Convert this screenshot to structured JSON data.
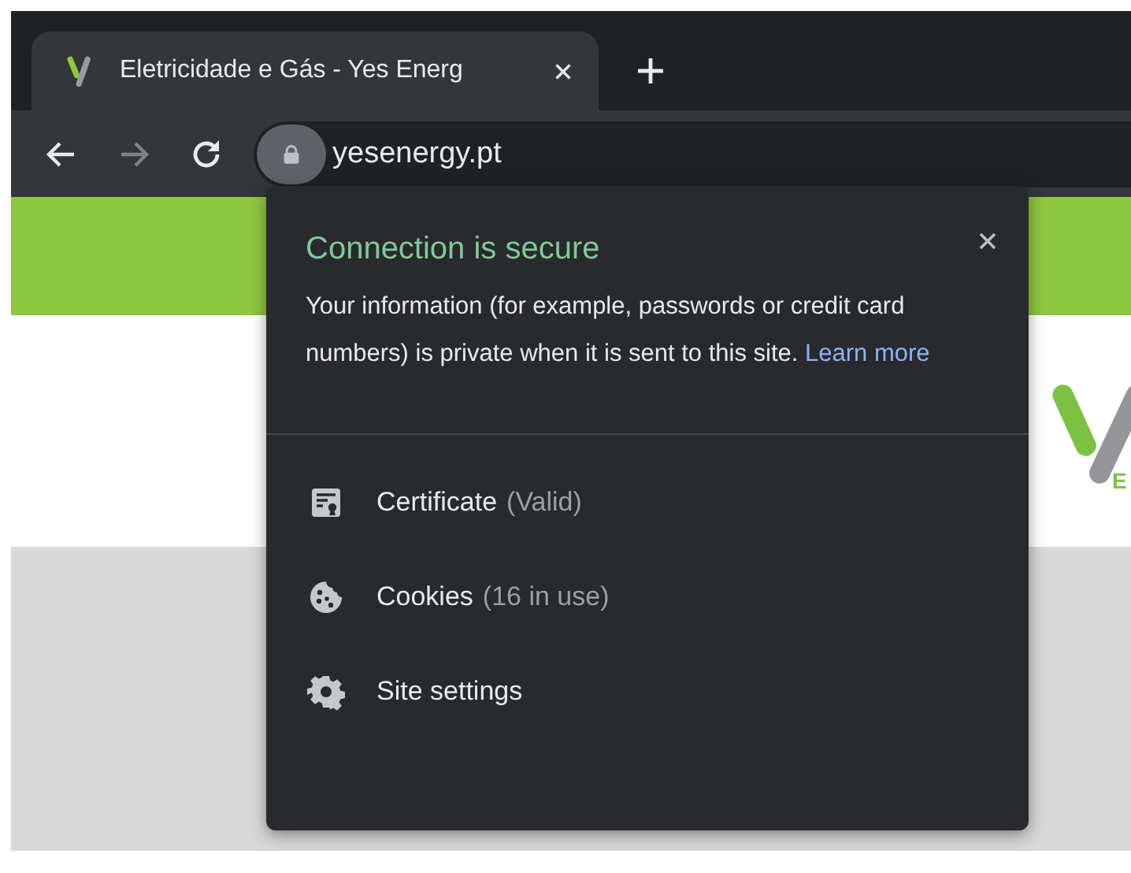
{
  "tabs": [
    {
      "title": "Eletricidade e Gás - Yes Energ",
      "selected": true
    }
  ],
  "toolbar": {
    "buttons": [
      {
        "kind": "back",
        "disabled": false
      },
      {
        "kind": "forward",
        "disabled": true
      },
      {
        "kind": "reload",
        "disabled": false
      }
    ]
  },
  "address_bar": {
    "url": "yesenergy.pt"
  },
  "page": {
    "logo_letter": "E"
  },
  "popup": {
    "title": "Connection is secure",
    "message": "Your information (for example, passwords or credit card numbers) is private when it is sent to this site.",
    "link": "Learn more",
    "items": [
      {
        "kind": "certificate",
        "label": "Certificate",
        "detail": "(Valid)"
      },
      {
        "kind": "cookies",
        "label": "Cookies",
        "detail": "(16 in use)"
      },
      {
        "kind": "settings",
        "label": "Site settings"
      }
    ]
  }
}
